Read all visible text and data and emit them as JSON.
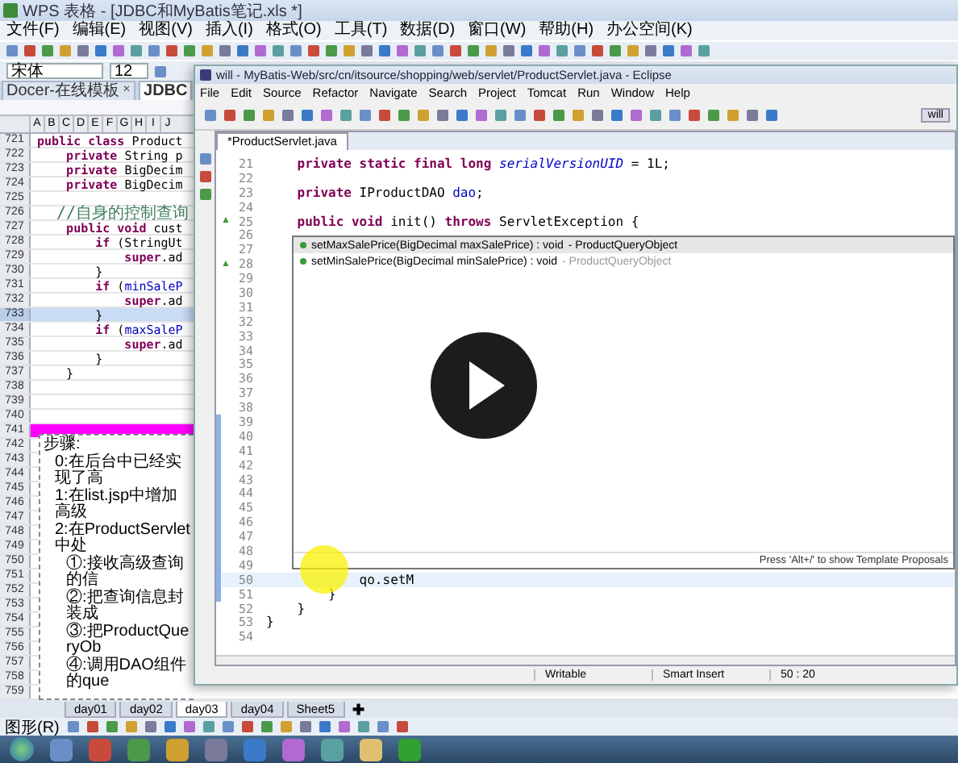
{
  "wps": {
    "title": "WPS 表格 - [JDBC和MyBatis笔记.xls *]",
    "menu": [
      "文件(F)",
      "编辑(E)",
      "视图(V)",
      "插入(I)",
      "格式(O)",
      "工具(T)",
      "数据(D)",
      "窗口(W)",
      "帮助(H)",
      "办公空间(K)"
    ],
    "font": "宋体",
    "font_size": "12",
    "doc_tabs": [
      {
        "label": "Docer-在线模板",
        "selected": false,
        "close": "✕"
      },
      {
        "label": "JDBC",
        "selected": true
      }
    ],
    "columns": [
      "A",
      "B",
      "C",
      "D",
      "E",
      "F",
      "G",
      "H",
      "I",
      "J"
    ],
    "rows": [
      {
        "number": "721",
        "selected": false,
        "tokens": [
          {
            "kind": "keyword",
            "text": "public class "
          },
          {
            "kind": "text",
            "text": "Product"
          }
        ]
      },
      {
        "number": "722",
        "selected": false,
        "tokens": [
          {
            "kind": "keyword",
            "text": "    private "
          },
          {
            "kind": "text",
            "text": "String p"
          }
        ]
      },
      {
        "number": "723",
        "selected": false,
        "tokens": [
          {
            "kind": "keyword",
            "text": "    private "
          },
          {
            "kind": "text",
            "text": "BigDecim"
          }
        ]
      },
      {
        "number": "724",
        "selected": false,
        "tokens": [
          {
            "kind": "keyword",
            "text": "    private "
          },
          {
            "kind": "text",
            "text": "BigDecim"
          }
        ]
      },
      {
        "number": "725",
        "selected": false
      },
      {
        "number": "726",
        "selected": false,
        "tokens": [
          {
            "kind": "comment",
            "text": "  //自身的控制查询"
          }
        ]
      },
      {
        "number": "727",
        "selected": false,
        "tokens": [
          {
            "kind": "keyword",
            "text": "    public void "
          },
          {
            "kind": "text",
            "text": "cust"
          }
        ]
      },
      {
        "number": "728",
        "selected": false,
        "tokens": [
          {
            "kind": "keyword",
            "text": "        if "
          },
          {
            "kind": "text",
            "text": "(StringUt"
          }
        ]
      },
      {
        "number": "729",
        "selected": false,
        "tokens": [
          {
            "kind": "keyword",
            "text": "            super"
          },
          {
            "kind": "text",
            "text": ".ad"
          }
        ]
      },
      {
        "number": "730",
        "selected": false,
        "tokens": [
          {
            "kind": "text",
            "text": "        }"
          }
        ]
      },
      {
        "number": "731",
        "selected": false,
        "tokens": [
          {
            "kind": "keyword",
            "text": "        if "
          },
          {
            "kind": "text",
            "text": "("
          },
          {
            "kind": "field",
            "text": "minSaleP"
          }
        ]
      },
      {
        "number": "732",
        "selected": false,
        "tokens": [
          {
            "kind": "keyword",
            "text": "            super"
          },
          {
            "kind": "text",
            "text": ".ad"
          }
        ]
      },
      {
        "number": "733",
        "selected": true,
        "tokens": [
          {
            "kind": "text",
            "text": "        }"
          }
        ]
      },
      {
        "number": "734",
        "selected": false,
        "tokens": [
          {
            "kind": "keyword",
            "text": "        if "
          },
          {
            "kind": "text",
            "text": "("
          },
          {
            "kind": "field",
            "text": "maxSaleP"
          }
        ]
      },
      {
        "number": "735",
        "selected": false,
        "tokens": [
          {
            "kind": "keyword",
            "text": "            super"
          },
          {
            "kind": "text",
            "text": ".ad"
          }
        ]
      },
      {
        "number": "736",
        "selected": false,
        "tokens": [
          {
            "kind": "text",
            "text": "        }"
          }
        ]
      },
      {
        "number": "737",
        "selected": false,
        "tokens": [
          {
            "kind": "text",
            "text": "    }"
          }
        ]
      },
      {
        "number": "738",
        "selected": false
      },
      {
        "number": "739",
        "selected": false
      },
      {
        "number": "740",
        "selected": false
      },
      {
        "number": "741",
        "selected": false,
        "color": "#ff00ff"
      },
      {
        "number": "742",
        "selected": false
      },
      {
        "number": "743",
        "selected": false
      },
      {
        "number": "744",
        "selected": false
      },
      {
        "number": "745",
        "selected": false
      },
      {
        "number": "746",
        "selected": false
      },
      {
        "number": "747",
        "selected": false
      },
      {
        "number": "748",
        "selected": false
      },
      {
        "number": "749",
        "selected": false
      },
      {
        "number": "750",
        "selected": false
      },
      {
        "number": "751",
        "selected": false
      },
      {
        "number": "752",
        "selected": false
      },
      {
        "number": "753",
        "selected": false
      },
      {
        "number": "754",
        "selected": false
      },
      {
        "number": "755",
        "selected": false
      },
      {
        "number": "756",
        "selected": false
      },
      {
        "number": "757",
        "selected": false
      },
      {
        "number": "758",
        "selected": false
      },
      {
        "number": "759",
        "selected": false
      }
    ],
    "text_box": {
      "title": "步骤:",
      "children": [
        {
          "text": "0:在后台中已经实现了高"
        },
        {
          "text": "1:在list.jsp中增加高级"
        },
        {
          "text": "2:在ProductServlet中处",
          "children": [
            {
              "text": "①:接收高级查询的信"
            },
            {
              "text": "②:把查询信息封装成"
            },
            {
              "text": "③:把ProductQueryOb"
            },
            {
              "text": "④:调用DAO组件的que"
            }
          ]
        }
      ]
    },
    "sheet_tabs": [
      {
        "label": "day01",
        "selected": false
      },
      {
        "label": "day02",
        "selected": false
      },
      {
        "label": "day03",
        "selected": true
      },
      {
        "label": "day04",
        "selected": false
      },
      {
        "label": "Sheet5",
        "selected": false
      }
    ],
    "add_tab": "✚",
    "drawing_menu": "图形(R)"
  },
  "eclipse": {
    "title": "will - MyBatis-Web/src/cn/itsource/shopping/web/servlet/ProductServlet.java - Eclipse",
    "menu": [
      "File",
      "Edit",
      "Source",
      "Refactor",
      "Navigate",
      "Search",
      "Project",
      "Tomcat",
      "Run",
      "Window",
      "Help"
    ],
    "perspective": "will",
    "editor_tab": "*ProductServlet.java",
    "lines": [
      {
        "number": "21",
        "current": false,
        "range": false,
        "tokens": [
          {
            "kind": "keyword",
            "text": "    private static final long "
          },
          {
            "kind": "constant",
            "text": "serialVersionUID"
          },
          {
            "kind": "text",
            "text": " = 1L;"
          }
        ]
      },
      {
        "number": "22",
        "current": false,
        "range": false
      },
      {
        "number": "23",
        "current": false,
        "range": false,
        "tokens": [
          {
            "kind": "keyword",
            "text": "    private "
          },
          {
            "kind": "text",
            "text": "IProductDAO "
          },
          {
            "kind": "field",
            "text": "dao"
          },
          {
            "kind": "text",
            "text": ";"
          }
        ]
      },
      {
        "number": "24",
        "current": false,
        "range": false
      },
      {
        "number": "25",
        "current": false,
        "range": false,
        "marker": "▲",
        "tokens": [
          {
            "kind": "keyword",
            "text": "    public void "
          },
          {
            "kind": "text",
            "text": "init() "
          },
          {
            "kind": "keyword",
            "text": "throws "
          },
          {
            "kind": "text",
            "text": "ServletException {"
          }
        ]
      },
      {
        "number": "26",
        "current": false,
        "range": false
      },
      {
        "number": "27",
        "current": false,
        "range": false
      },
      {
        "number": "28",
        "current": false,
        "range": false,
        "marker": "▲"
      },
      {
        "number": "29",
        "current": false,
        "range": false
      },
      {
        "number": "30",
        "current": false,
        "range": false
      },
      {
        "number": "31",
        "current": false,
        "range": false
      },
      {
        "number": "32",
        "current": false,
        "range": false
      },
      {
        "number": "33",
        "current": false,
        "range": false
      },
      {
        "number": "34",
        "current": false,
        "range": false
      },
      {
        "number": "35",
        "current": false,
        "range": false
      },
      {
        "number": "36",
        "current": false,
        "range": false
      },
      {
        "number": "37",
        "current": false,
        "range": false
      },
      {
        "number": "38",
        "current": false,
        "range": false
      },
      {
        "number": "39",
        "current": false,
        "range": true
      },
      {
        "number": "40",
        "current": false,
        "range": true
      },
      {
        "number": "41",
        "current": false,
        "range": true
      },
      {
        "number": "42",
        "current": false,
        "range": true
      },
      {
        "number": "43",
        "current": false,
        "range": true
      },
      {
        "number": "44",
        "current": false,
        "range": true
      },
      {
        "number": "45",
        "current": false,
        "range": true
      },
      {
        "number": "46",
        "current": false,
        "range": true
      },
      {
        "number": "47",
        "current": false,
        "range": true
      },
      {
        "number": "48",
        "current": false,
        "range": true
      },
      {
        "number": "49",
        "current": false,
        "range": true
      },
      {
        "number": "50",
        "current": true,
        "range": true,
        "tokens": [
          {
            "kind": "text",
            "text": "            qo.setM"
          }
        ]
      },
      {
        "number": "51",
        "current": false,
        "range": true,
        "tokens": [
          {
            "kind": "text",
            "text": "        }"
          }
        ]
      },
      {
        "number": "52",
        "current": false,
        "range": false,
        "tokens": [
          {
            "kind": "text",
            "text": "    }"
          }
        ]
      },
      {
        "number": "53",
        "current": false,
        "range": false,
        "tokens": [
          {
            "kind": "text",
            "text": "}"
          }
        ]
      },
      {
        "number": "54",
        "current": false,
        "range": false
      }
    ],
    "proposals": {
      "items": [
        {
          "signature": "setMaxSalePrice(BigDecimal maxSalePrice) : void",
          "owner": " - ProductQueryObject",
          "selected": true
        },
        {
          "signature": "setMinSalePrice(BigDecimal minSalePrice) : void",
          "owner": " - ProductQueryObject",
          "selected": false
        }
      ],
      "hint": "Press 'Alt+/' to show Template Proposals"
    },
    "status": [
      "Writable",
      "Smart Insert",
      "50 : 20"
    ]
  }
}
